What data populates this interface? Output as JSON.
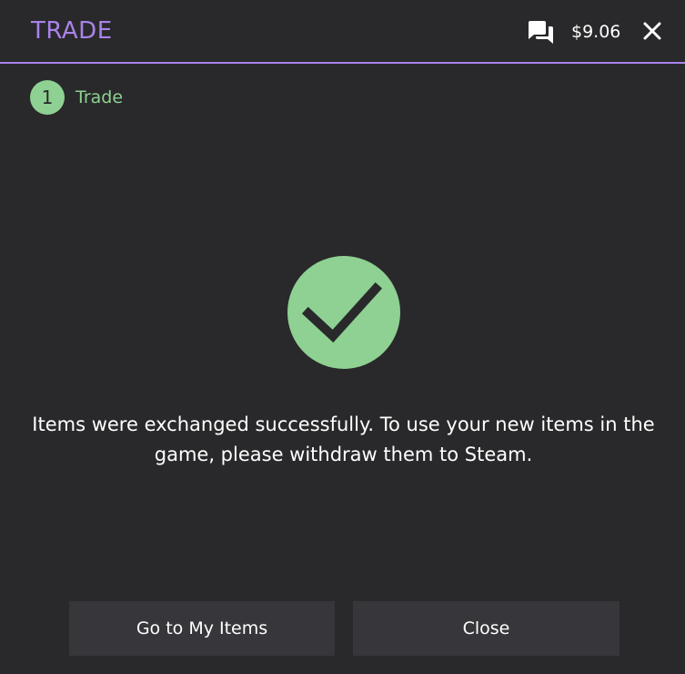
{
  "header": {
    "title": "TRADE",
    "chat_icon": "chat-bubbles-icon",
    "balance": "$9.06",
    "close_icon": "close-icon"
  },
  "steps": [
    {
      "number": "1",
      "label": "Trade"
    }
  ],
  "status": {
    "icon": "checkmark-circle-icon",
    "message": "Items were exchanged successfully. To use your new items in the game, please withdraw them to Steam."
  },
  "actions": {
    "my_items_label": "Go to My Items",
    "close_label": "Close"
  },
  "colors": {
    "accent": "#a982ea",
    "success": "#8ed192",
    "background": "#29292b",
    "button": "#37373b"
  }
}
